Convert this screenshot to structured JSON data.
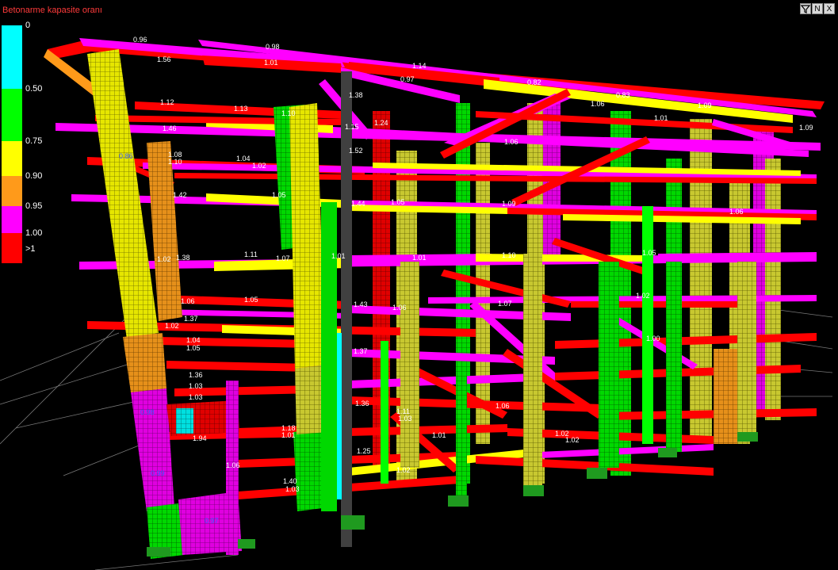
{
  "title": "Betonarme kapasite oranı",
  "legend": {
    "entries": [
      {
        "label": "0",
        "color": "#00ffff"
      },
      {
        "label": "0.50",
        "color": "#00ff00"
      },
      {
        "label": "0.75",
        "color": "#ffff00"
      },
      {
        "label": "0.90",
        "color": "#ff9a1a"
      },
      {
        "label": "0.95",
        "color": "#ff00ff"
      },
      {
        "label": "1.00",
        "color": "#ff0000"
      },
      {
        "label": ">1",
        "color": "#ff0000"
      }
    ]
  },
  "toolbar": {
    "filter_icon": "filter-icon",
    "n_label": "N",
    "close_label": "X"
  },
  "colors": {
    "background": "#000000",
    "red": "#ff0000",
    "magenta": "#ff00ff",
    "yellow": "#ffff00",
    "green": "#00ff00",
    "orange": "#ff9a1a",
    "cyan": "#00ffff"
  },
  "beam_values": {
    "top_front_1": "0.96",
    "top_front_2": "0.98",
    "top_1": "1.56",
    "top_2": "1.01",
    "top_3": "1.14",
    "top_4": "0.97",
    "top_5": "0.82",
    "top_6": "0.83",
    "top_7": "1.06",
    "top_8": "1.09",
    "l2_1": "1.12",
    "l2_2": "1.13",
    "l2_3": "1.46",
    "l2_4": "1.10",
    "l2_5": "1.38",
    "l2_6": "1.15",
    "l2_7": "1.24",
    "l2_8": "1.09",
    "l2_9": "1.01",
    "l3_1": "1.08",
    "l3_2": "1.10",
    "l3_3": "1.04",
    "l3_4": "1.02",
    "l3_5": "1.52",
    "l3_6": "1.06",
    "l4_1": "1.42",
    "l4_2": "1.05",
    "l4_3": "1.44",
    "l4_4": "1.05",
    "l4_5": "1.09",
    "l4_6": "1.06",
    "l5_1": "1.02",
    "l5_2": "1.38",
    "l5_3": "1.11",
    "l5_4": "1.07",
    "l5_5": "1.01",
    "l5_6": "1.01",
    "l5_7": "1.10",
    "l5_8": "1.05",
    "l6_1": "1.06",
    "l6_2": "1.05",
    "l6_3": "1.43",
    "l6_4": "1.06",
    "l6_5": "1.07",
    "l6_6": "1.02",
    "l7_1": "1.37",
    "l7_2": "1.02",
    "l7_3": "1.04",
    "l7_4": "1.05",
    "l7_5": "1.37",
    "l7_6": "1.00",
    "l8_1": "1.36",
    "l8_2": "1.03",
    "l8_3": "1.03",
    "l8_4": "1.36",
    "l8_5": "1.11",
    "l8_6": "1.03",
    "l8_7": "1.06",
    "l9_1": "1.94",
    "l9_2": "1.18",
    "l9_3": "1.01",
    "l9_4": "1.01",
    "l9_5": "1.02",
    "l9_6": "1.02",
    "l10_1": "1.25",
    "l10_2": "1.02",
    "l10_3": "1.40",
    "l10_4": "1.03",
    "l10_5": "1.06",
    "w_1": "0.99",
    "w_2": "0.97",
    "w_3": "0.98",
    "w_4": "0.86"
  }
}
